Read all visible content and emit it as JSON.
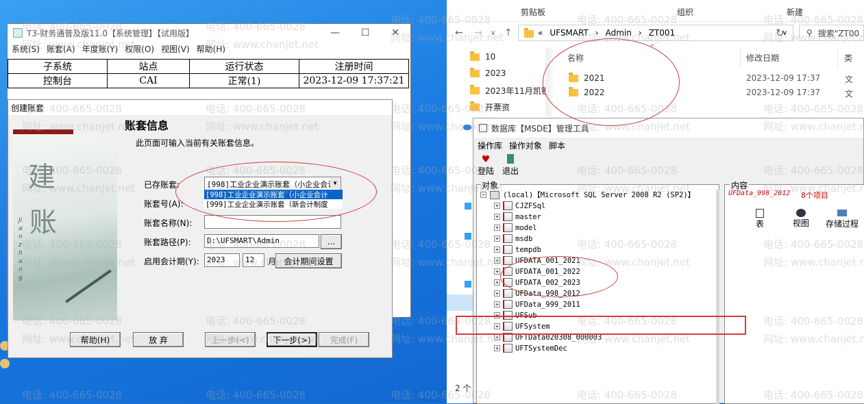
{
  "system_manager": {
    "title": "T3-财务通普及版11.0【系统管理】【试用版】",
    "menu": [
      "系统(S)",
      "账套(A)",
      "年度账(Y)",
      "权限(O)",
      "视图(V)",
      "帮助(H)"
    ],
    "table_headers": [
      "子系统",
      "站点",
      "运行状态",
      "注册时间"
    ],
    "table_row": [
      "控制台",
      "CAI",
      "正常(1)",
      "2023-12-09 17:37:21"
    ]
  },
  "create_dialog": {
    "title": "创建账套",
    "art_big1": "建",
    "art_big2": "账",
    "art_vertical": "Jianzhang",
    "heading": "账套信息",
    "description": "此页面可输入当前有关账套信息。",
    "labels": {
      "existing": "已存账套:",
      "number": "账套号(A):",
      "name": "账套名称(N):",
      "path": "账套路径(P):",
      "period": "启用会计期(Y):",
      "month_unit": "月"
    },
    "existing_selected": "[998]工业企业演示账套（小企业会计",
    "existing_options": [
      "[998]工业企业演示账套（小企业会计",
      "[999]工业企业演示账套（新会计制度"
    ],
    "number_value": "",
    "name_value": "",
    "path_value": "D:\\UFSMART\\Admin",
    "browse_label": "...",
    "year_value": "2023",
    "month_value": "12",
    "period_button": "会计期间设置",
    "buttons": {
      "help": "帮助(H)",
      "cancel": "放 弃",
      "prev": "上一步(<)",
      "next": "下一步(>)",
      "finish": "完成(F)"
    }
  },
  "explorer": {
    "ribbon": [
      "剪贴板",
      "组织",
      "新建"
    ],
    "breadcrumb": [
      "«",
      "UFSMART",
      "Admin",
      "ZT001"
    ],
    "search_placeholder": "搜索\"ZT00",
    "nav_items": [
      "10",
      "2023",
      "2023年11月凯钢",
      "开票资"
    ],
    "columns": {
      "name": "名称",
      "date": "修改日期",
      "type": "类"
    },
    "files": [
      {
        "name": "2021",
        "date": "2023-12-09 17:37",
        "type": "文"
      },
      {
        "name": "2022",
        "date": "2023-12-09 17:37",
        "type": "文"
      }
    ],
    "status_count": "2 个"
  },
  "msde": {
    "title": "数据库【MSDE】管理工具",
    "menu": [
      "操作库",
      "操作对象",
      "脚本"
    ],
    "toolbar": [
      "登陆",
      "退出"
    ],
    "tree_group": "对象",
    "content_group": "内容",
    "root": "(local)【Microsoft SQL Server 2008 R2 (SP2)】",
    "databases": [
      "CJZFSql",
      "master",
      "model",
      "msdb",
      "tempdb",
      "UFDATA_001_2021",
      "UFDATA_001_2022",
      "UFDATA_002_2023",
      "UFData_998_2012",
      "UFData_999_2011",
      "UFSub",
      "UFSystem",
      "UFTData020308_000003",
      "UFTSystemDec"
    ],
    "content_selected": "UFData_998_2012",
    "content_count": "8个项目",
    "content_items": [
      "表",
      "视图",
      "存储过程"
    ]
  },
  "watermarks": {
    "phone": "电话: 400-665-0028",
    "site": "网址: www.chanjet.net"
  },
  "colors": {
    "annotation": "#d23a3a",
    "selection": "#0a64c8"
  }
}
